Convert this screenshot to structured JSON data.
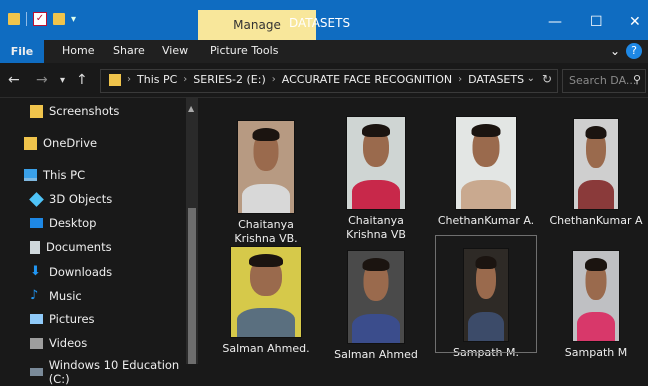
{
  "titlebar": {
    "context_tab": "Manage",
    "title": "DATASETS",
    "window_buttons": [
      "—",
      "☐",
      "✕"
    ]
  },
  "ribbon": {
    "tabs": [
      "File",
      "Home",
      "Share",
      "View",
      "Picture Tools"
    ]
  },
  "address": {
    "crumbs": [
      "This PC",
      "SERIES-2 (E:)",
      "ACCURATE FACE RECOGNITION",
      "DATASETS"
    ],
    "search_placeholder": "Search DA..."
  },
  "sidebar": {
    "items": [
      {
        "label": "Screenshots",
        "icon": "folder-icon"
      },
      {
        "label": "OneDrive",
        "icon": "folder-icon"
      },
      {
        "label": "This PC",
        "icon": "monitor-icon"
      },
      {
        "label": "3D Objects",
        "icon": "cube-icon"
      },
      {
        "label": "Desktop",
        "icon": "desktop-icon"
      },
      {
        "label": "Documents",
        "icon": "document-icon"
      },
      {
        "label": "Downloads",
        "icon": "download-icon"
      },
      {
        "label": "Music",
        "icon": "music-icon"
      },
      {
        "label": "Pictures",
        "icon": "pictures-icon"
      },
      {
        "label": "Videos",
        "icon": "video-icon"
      },
      {
        "label": "Windows 10 Education (C:)",
        "icon": "drive-icon"
      }
    ]
  },
  "files": [
    {
      "name": "Chaitanya Krishna VB.",
      "bg": "#b79a82",
      "shirt": "#d8d8d8"
    },
    {
      "name": "Chaitanya Krishna VB",
      "bg": "#cfd5d3",
      "shirt": "#c8284a"
    },
    {
      "name": "ChethanKumar A.",
      "bg": "#e3e6e4",
      "shirt": "#c9a98f"
    },
    {
      "name": "ChethanKumar A",
      "bg": "#cfcfcf",
      "shirt": "#8a3a3a"
    },
    {
      "name": "Salman Ahmed.",
      "bg": "#d6c94a",
      "shirt": "#5a6f7f"
    },
    {
      "name": "Salman Ahmed",
      "bg": "#4a4a4a",
      "shirt": "#3b4d8c"
    },
    {
      "name": "Sampath M.",
      "bg": "#2e2a26",
      "shirt": "#3c4b69"
    },
    {
      "name": "Sampath M",
      "bg": "#bfc0c3",
      "shirt": "#d8386a"
    }
  ]
}
